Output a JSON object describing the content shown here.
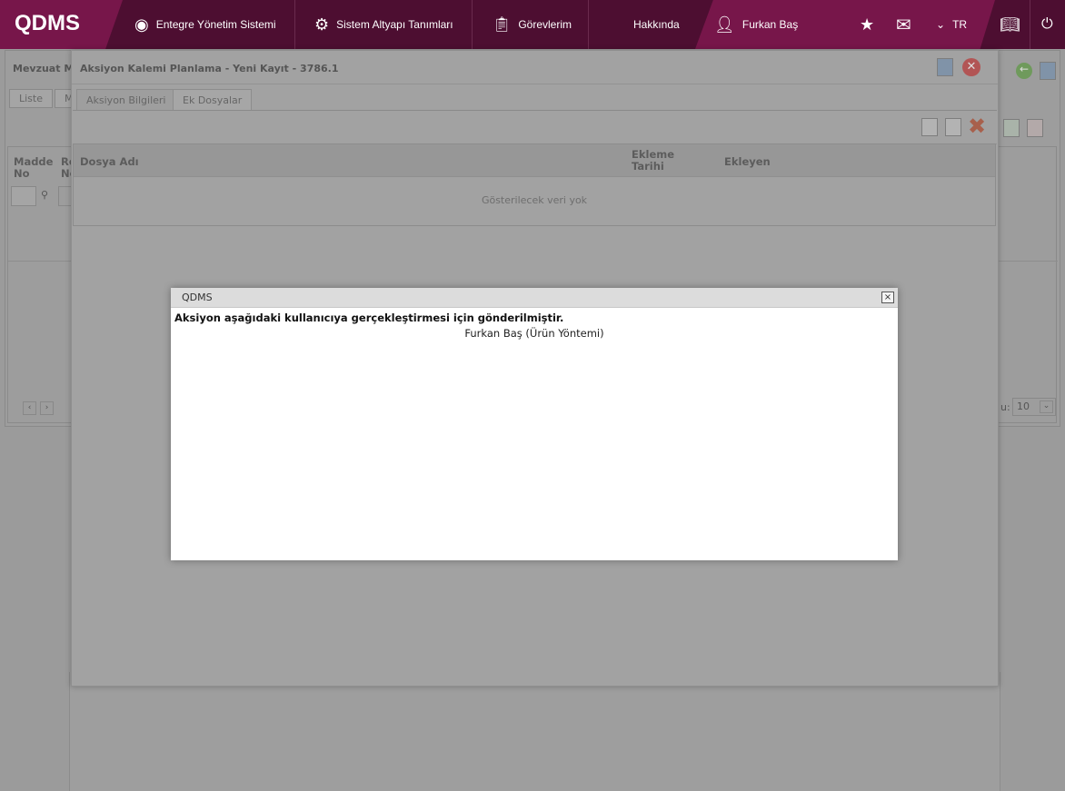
{
  "topbar": {
    "logo": "QDMS",
    "nav": [
      {
        "label": "Entegre Yönetim Sistemi",
        "icon": "qdms-circle-icon"
      },
      {
        "label": "Sistem Altyapı Tanımları",
        "icon": "gear-icon"
      },
      {
        "label": "Görevlerim",
        "icon": "clipboard-check-icon"
      },
      {
        "label": "Hakkında"
      }
    ],
    "user": "Furkan Baş",
    "language": "TR"
  },
  "background_page": {
    "title": "Mevzuat Ma",
    "tabs": [
      "Liste",
      "M"
    ],
    "columns": [
      "Madde No",
      "Re No"
    ],
    "page_size_label": "u:",
    "page_size": "10"
  },
  "record_window": {
    "title": "Aksiyon Kalemi Planlama - Yeni Kayıt - 3786.1",
    "tabs": [
      "Aksiyon Bilgileri",
      "Ek Dosyalar"
    ],
    "active_tab": "Ek Dosyalar",
    "grid": {
      "columns": [
        "Dosya Adı",
        "Ekleme Tarihi",
        "Ekleyen"
      ],
      "empty_text": "Gösterilecek veri yok"
    }
  },
  "dialog": {
    "title": "QDMS",
    "close": "×",
    "message": "Aksiyon aşağıdaki kullanıcıya gerçekleştirmesi için gönderilmiştir.",
    "recipient": "Furkan Baş (Ürün Yöntemi)"
  }
}
